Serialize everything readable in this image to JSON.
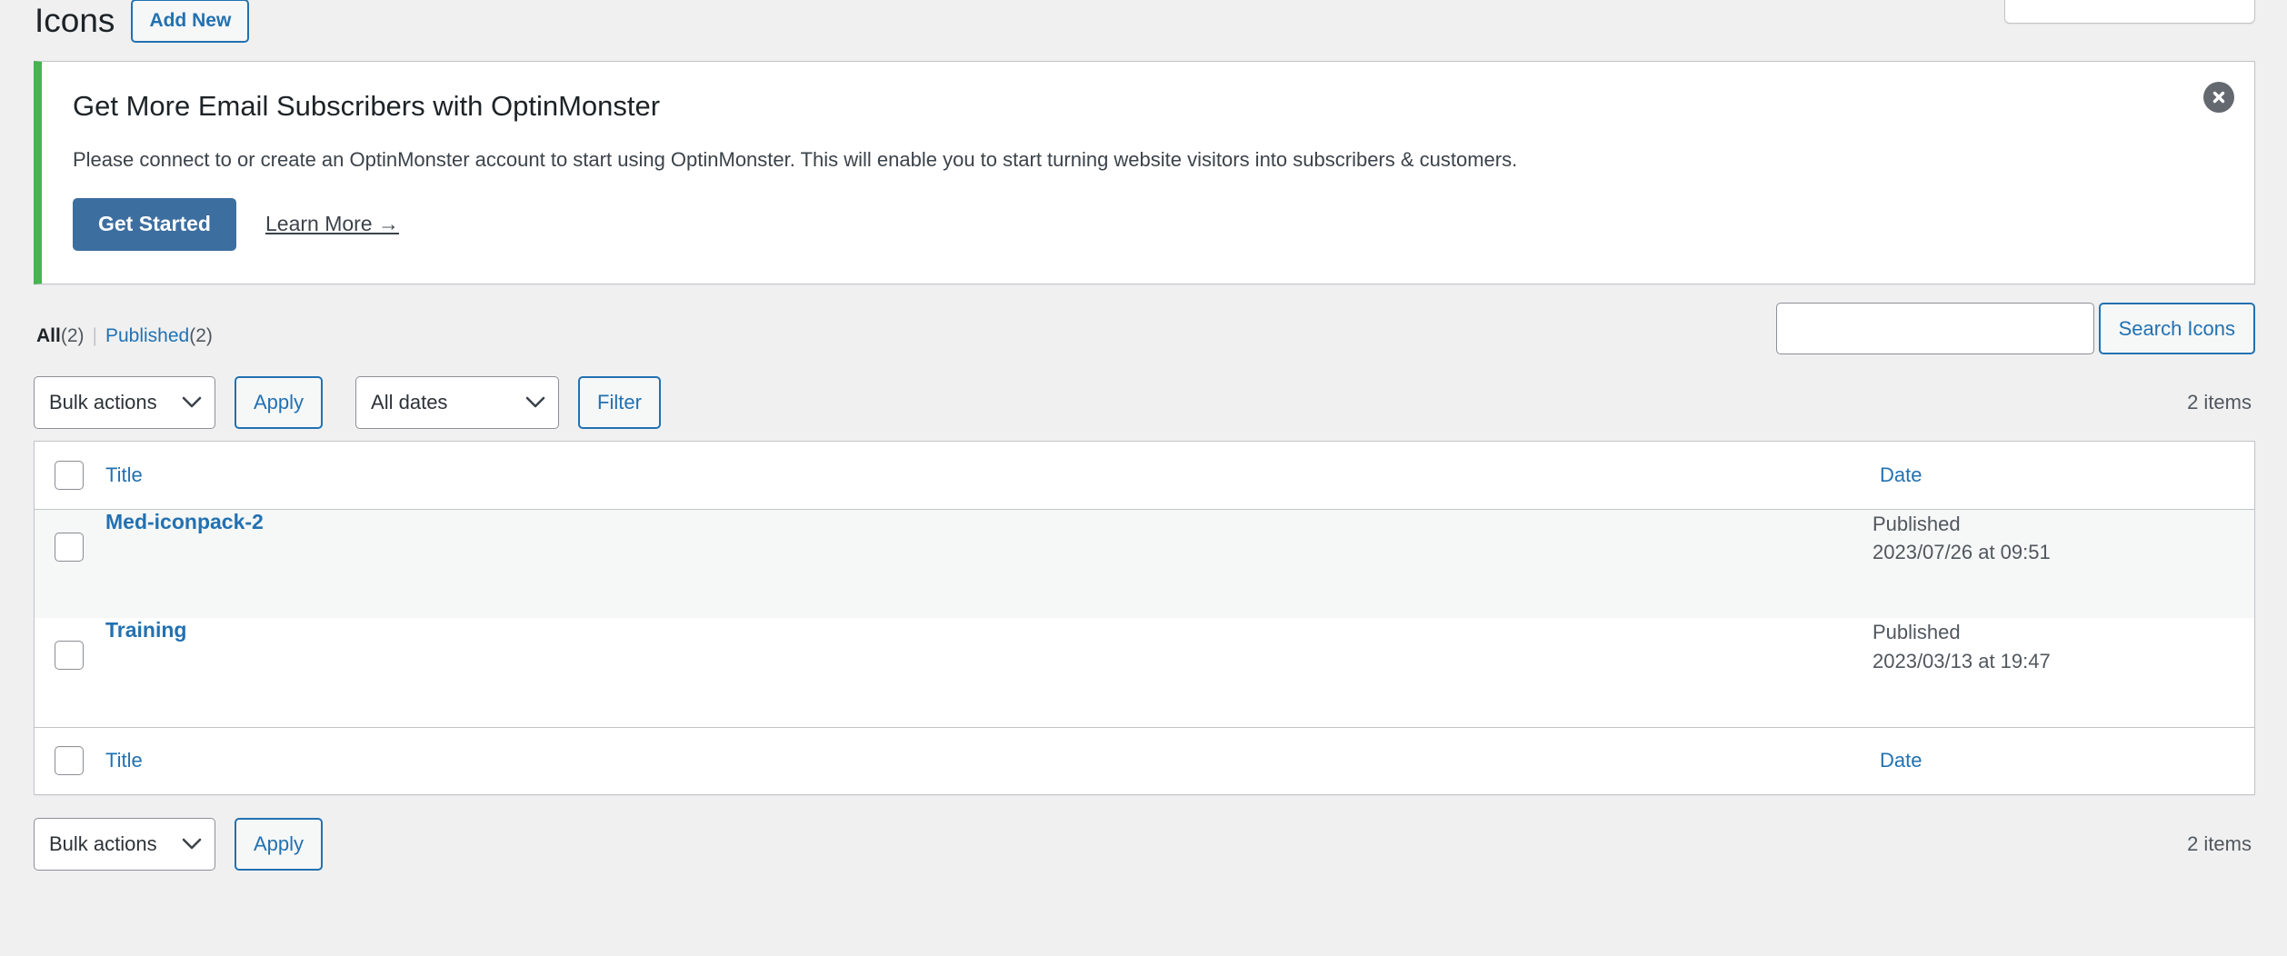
{
  "page": {
    "title": "Icons",
    "add_new_label": "Add New"
  },
  "notice": {
    "title": "Get More Email Subscribers with OptinMonster",
    "description": "Please connect to or create an OptinMonster account to start using OptinMonster. This will enable you to start turning website visitors into subscribers & customers.",
    "primary_button": "Get Started",
    "secondary_link": "Learn More →",
    "dismiss_icon": "close-circle-icon",
    "accent_color": "#46b450",
    "button_color": "#3c6e9f"
  },
  "views": {
    "all_label": "All",
    "all_count": "(2)",
    "separator": "|",
    "published_label": "Published",
    "published_count": "(2)"
  },
  "search": {
    "value": "",
    "placeholder": "",
    "button_label": "Search Icons"
  },
  "tablenav_top": {
    "bulk_actions_label": "Bulk actions",
    "apply_label": "Apply",
    "dates_label": "All dates",
    "filter_label": "Filter",
    "items_count": "2 items"
  },
  "tablenav_bottom": {
    "bulk_actions_label": "Bulk actions",
    "apply_label": "Apply",
    "items_count": "2 items"
  },
  "table": {
    "columns": {
      "title": "Title",
      "date": "Date"
    },
    "rows": [
      {
        "title": "Med-iconpack-2",
        "status": "Published",
        "date": "2023/07/26 at 09:51"
      },
      {
        "title": "Training",
        "status": "Published",
        "date": "2023/03/13 at 19:47"
      }
    ]
  }
}
